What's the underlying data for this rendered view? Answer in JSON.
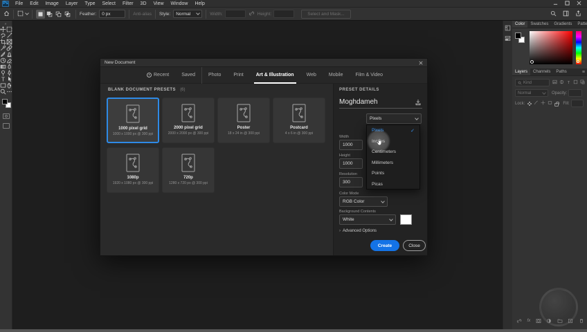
{
  "titlebar": {
    "logo": "Ps",
    "menus": [
      "File",
      "Edit",
      "Image",
      "Layer",
      "Type",
      "Select",
      "Filter",
      "3D",
      "View",
      "Window",
      "Help"
    ]
  },
  "options_bar": {
    "feather_label": "Feather:",
    "feather_value": "0 px",
    "anti_alias_label": "Anti-alias",
    "style_label": "Style:",
    "style_value": "Normal",
    "width_label": "Width:",
    "height_label": "Height:",
    "select_and_mask_label": "Select and Mask..."
  },
  "toolbar": {
    "tools": [
      "move",
      "rectangular-marquee",
      "lasso",
      "quick-selection",
      "crop",
      "frame",
      "eyedropper",
      "healing-brush",
      "brush",
      "clone-stamp",
      "history-brush",
      "eraser",
      "gradient",
      "blur",
      "dodge",
      "pen",
      "type",
      "path-selection",
      "rectangle",
      "hand",
      "zoom",
      "edit-toolbar"
    ]
  },
  "dialog": {
    "title": "New Document",
    "tabs": [
      "Recent",
      "Saved",
      "Photo",
      "Print",
      "Art & Illustration",
      "Web",
      "Mobile",
      "Film & Video"
    ],
    "active_tab": "Art & Illustration",
    "presets_title": "BLANK DOCUMENT PRESETS",
    "presets_count": "(6)",
    "presets": [
      {
        "name": "1000 pixel grid",
        "spec": "1000 x 1000 px @ 300 ppi"
      },
      {
        "name": "2000 pixel grid",
        "spec": "2000 x 2000 px @ 300 ppi"
      },
      {
        "name": "Poster",
        "spec": "18 x 24 in @ 300 ppi"
      },
      {
        "name": "Postcard",
        "spec": "4 x 6 in @ 300 ppi"
      },
      {
        "name": "1080p",
        "spec": "1920 x 1080 px @ 300 ppi"
      },
      {
        "name": "720p",
        "spec": "1280 x 720 px @ 300 ppi"
      }
    ],
    "details": {
      "header": "PRESET DETAILS",
      "doc_name": "Moghdameh",
      "width_label": "Width",
      "width_value": "1000",
      "unit_value": "Pixels",
      "height_label": "Height",
      "height_value": "1000",
      "resolution_label": "Resolution",
      "resolution_value": "300",
      "color_mode_label": "Color Mode",
      "color_mode_value": "RGB Color",
      "background_label": "Background Contents",
      "background_value": "White",
      "advanced_label": "Advanced Options",
      "create_label": "Create",
      "close_label": "Close"
    },
    "unit_menu": {
      "items": [
        "Pixels",
        "Inches",
        "Centimeters",
        "Millimeters",
        "Points",
        "Picas"
      ],
      "selected": "Pixels",
      "hovered": "Inches",
      "check": "✓"
    }
  },
  "panels": {
    "color": {
      "tabs": [
        "Color",
        "Swatches",
        "Gradients",
        "Patterns"
      ]
    },
    "layers": {
      "tabs": [
        "Layers",
        "Channels",
        "Paths"
      ],
      "filter_label": "Kind",
      "blend_mode": "Normal",
      "opacity_label": "Opacity:",
      "lock_label": "Lock:",
      "fill_label": "Fill:"
    }
  },
  "colors": {
    "accent_blue": "#1473e6",
    "selection_border": "#2e8ae6",
    "menu_selected_text": "#3a97f8"
  }
}
